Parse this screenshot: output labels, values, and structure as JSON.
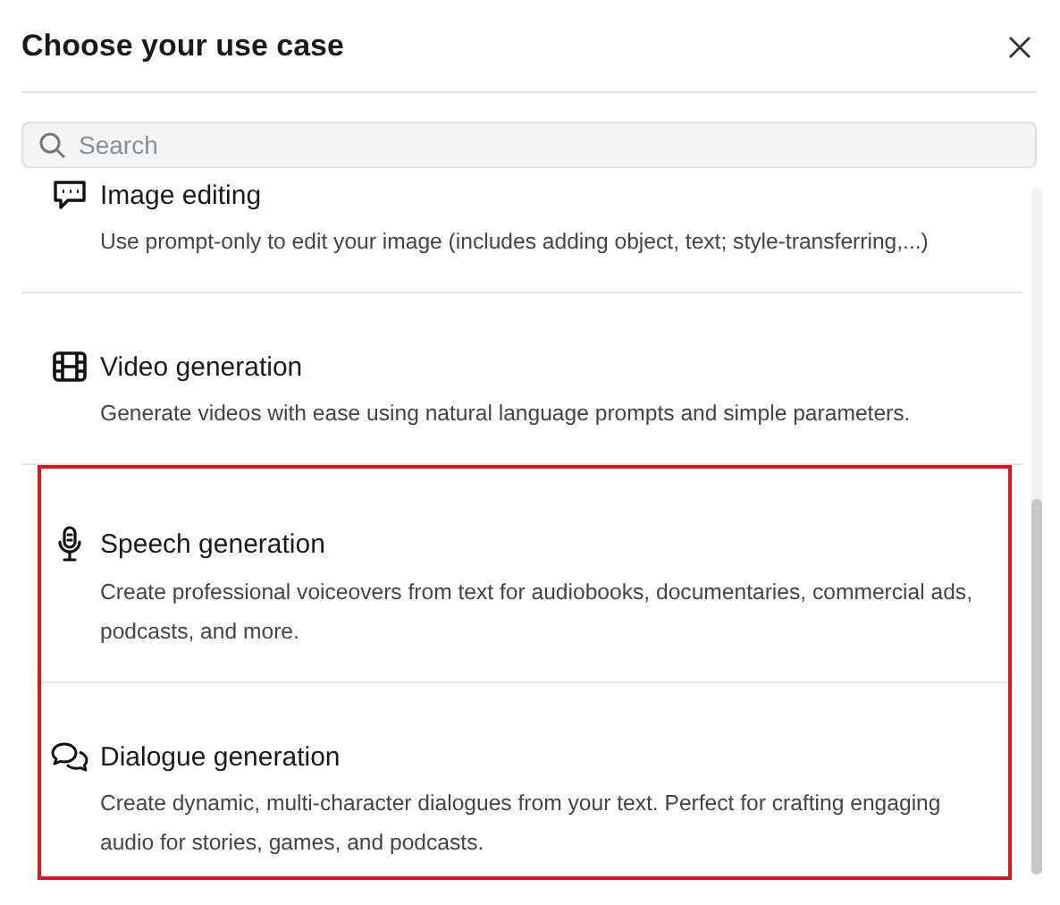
{
  "dialog": {
    "title": "Choose your use case"
  },
  "search": {
    "placeholder": "Search"
  },
  "items": [
    {
      "title": "Image editing",
      "description": "Use prompt-only to edit your image (includes adding object, text; style-transferring,...)",
      "highlighted": false
    },
    {
      "title": "Video generation",
      "description": "Generate videos with ease using natural language prompts and simple parameters.",
      "highlighted": false
    },
    {
      "title": "Speech generation",
      "description": "Create professional voiceovers from text for audiobooks, documentaries, commercial ads, podcasts, and more.",
      "highlighted": true
    },
    {
      "title": "Dialogue generation",
      "description": "Create dynamic, multi-character dialogues from your text. Perfect for crafting engaging audio for stories, games, and podcasts.",
      "highlighted": true
    }
  ]
}
